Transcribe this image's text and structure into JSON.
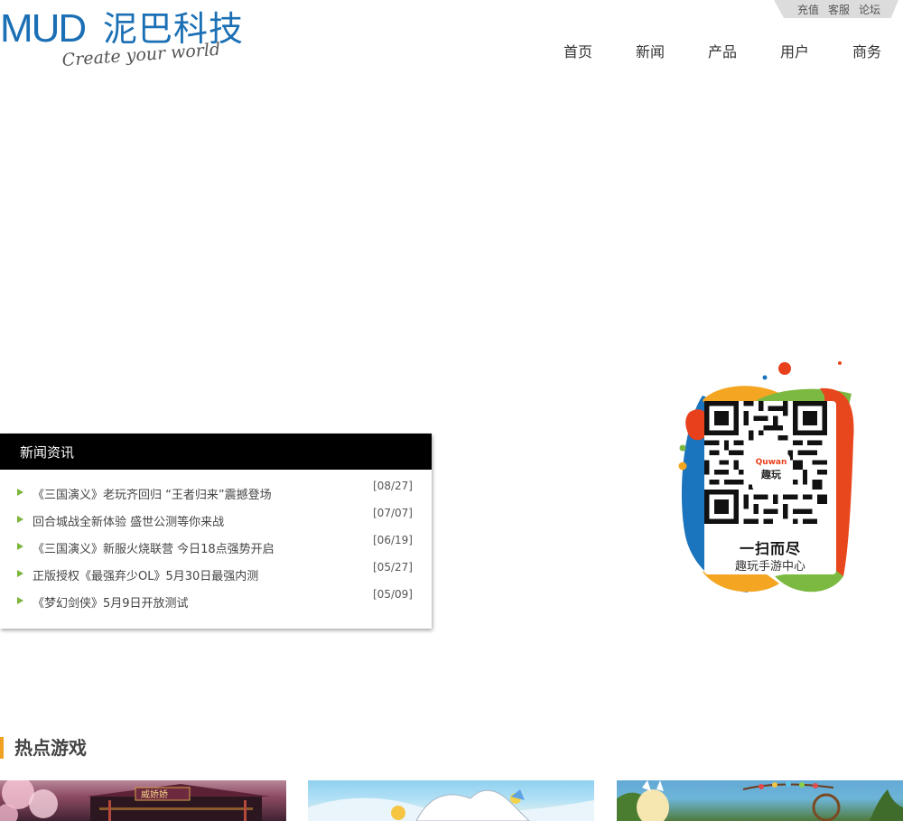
{
  "header": {
    "logo_mud": "MUD",
    "logo_cn": "泥巴科技",
    "slogan": "Create your world",
    "top_links": [
      "充值",
      "客服",
      "论坛"
    ],
    "nav": [
      "首页",
      "新闻",
      "产品",
      "用户",
      "商务"
    ]
  },
  "news": {
    "heading": "新闻资讯",
    "items": [
      {
        "title": "《三国演义》老玩齐回归 “王者归来”震撼登场",
        "date": "[08/27]"
      },
      {
        "title": "回合城战全新体验 盛世公测等你来战",
        "date": "[07/07]"
      },
      {
        "title": "《三国演义》新服火烧联营 今日18点强势开启",
        "date": "[06/19]"
      },
      {
        "title": "正版授权《最强弃少OL》5月30日最强内测",
        "date": "[05/27]"
      },
      {
        "title": "《梦幻剑侠》5月9日开放测试",
        "date": "[05/09]"
      }
    ]
  },
  "qr": {
    "badge_en": "Quwan",
    "badge_cn": "趣玩",
    "line1": "一扫而尽",
    "line2": "趣玩手游中心"
  },
  "hot_games": {
    "heading": "热点游戏",
    "game1_sign": "威娇娇"
  },
  "colors": {
    "brand_blue": "#1b6fb4",
    "accent_orange": "#f0a023",
    "bullet_green": "#7bb53b",
    "news_header_bg": "#000000"
  }
}
